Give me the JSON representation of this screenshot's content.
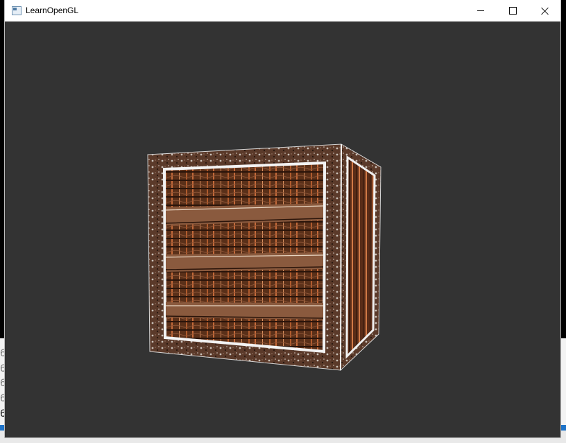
{
  "window": {
    "title": "LearnOpenGL",
    "buttons": {
      "minimize": "minimize",
      "maximize": "maximize",
      "close": "close"
    }
  },
  "viewport": {
    "clear_color": "#333333",
    "object": "textured-crate-cube",
    "effect": "edge-detection-kernel"
  },
  "background_ide": {
    "line_prefixes": [
      "6",
      "6",
      "6",
      "6",
      "6"
    ]
  },
  "colors": {
    "titlebar": "#ffffff",
    "accent": "#1e73c8",
    "wood_dark": "#3a2214",
    "wood_mid": "#6e3e22",
    "frame_highlight": "#f3f3f3"
  }
}
